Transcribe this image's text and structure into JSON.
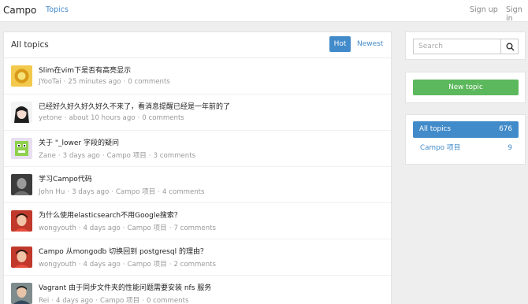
{
  "navbar": {
    "brand": "Campo",
    "topics": "Topics",
    "sign_up": "Sign up",
    "sign_in": "Sign in"
  },
  "main": {
    "title": "All topics",
    "tab_hot": "Hot",
    "tab_newest": "Newest",
    "topics": [
      {
        "title": "Slim在vim下是否有高亮显示",
        "author": "JYooTai",
        "time": "25 minutes ago",
        "node": "",
        "comments": "0 comments",
        "avatar_icon": "yellow-avatar"
      },
      {
        "title": "已经好久好久好久好久不来了，看消息提醒已经是一年前的了",
        "author": "yetone",
        "time": "about 10 hours ago",
        "node": "",
        "comments": "0 comments",
        "avatar_icon": "anime-avatar"
      },
      {
        "title": "关于 \"_lower 字段的疑问",
        "author": "Zane",
        "time": "3 days ago",
        "node": "Campo 项目",
        "comments": "3 comments",
        "avatar_icon": "green-robot-avatar"
      },
      {
        "title": "学习Campo代码",
        "author": "John Hu",
        "time": "3 days ago",
        "node": "Campo 项目",
        "comments": "4 comments",
        "avatar_icon": "grey-photo-avatar"
      },
      {
        "title": "为什么使用elasticsearch不用Google搜索？",
        "author": "wongyouth",
        "time": "4 days ago",
        "node": "Campo 项目",
        "comments": "7 comments",
        "avatar_icon": "red-photo-avatar"
      },
      {
        "title": "Campo 从mongodb 切换回到 postgresql 的理由？",
        "author": "wongyouth",
        "time": "4 days ago",
        "node": "Campo 项目",
        "comments": "2 comments",
        "avatar_icon": "red-photo-avatar"
      },
      {
        "title": "Vagrant 由于同步文件夹的性能问题需要安装 nfs 服务",
        "author": "Rei",
        "time": "4 days ago",
        "node": "Campo 项目",
        "comments": "0 comments",
        "avatar_icon": "person-photo-avatar"
      }
    ]
  },
  "sidebar": {
    "search_placeholder": "Search",
    "new_topic": "New topic",
    "nodes": [
      {
        "label": "All topics",
        "count": "676"
      },
      {
        "label": "Campo 项目",
        "count": "9"
      }
    ]
  },
  "colors": {
    "primary": "#428bca",
    "success": "#5cb85c",
    "muted": "#999999"
  }
}
